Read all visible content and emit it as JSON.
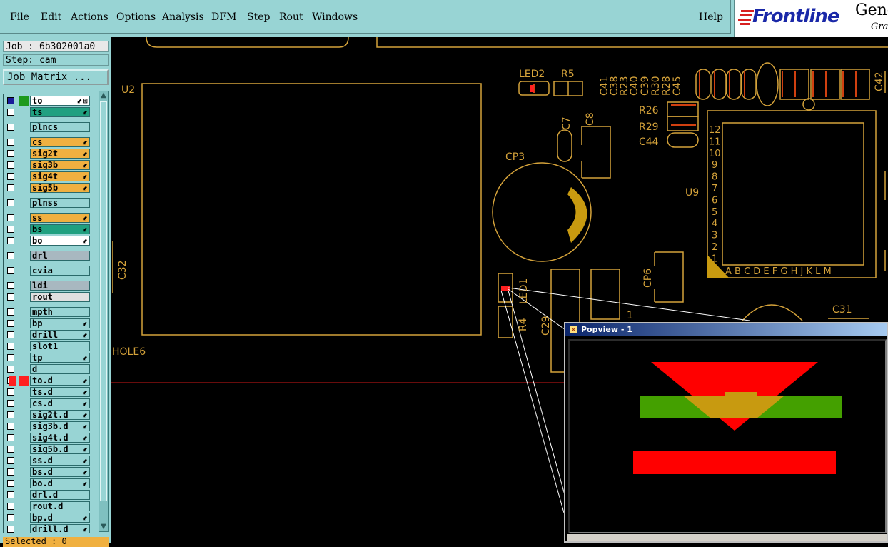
{
  "menubar": {
    "items": [
      "File",
      "Edit",
      "Actions",
      "Options",
      "Analysis",
      "DFM",
      "Step",
      "Rout",
      "Windows"
    ],
    "help": "Help",
    "logo": "Frontline",
    "logo_product": "Gene",
    "logo_sub": "Gra"
  },
  "sidebar": {
    "job": "Job : 6b302001a0",
    "step": "Step: cam",
    "job_matrix_button": "Job Matrix ...",
    "selected": "Selected : 0",
    "layers": [
      {
        "name": "to",
        "color": "#ffffff",
        "cb": "sel",
        "swatch": "#1a1a9a",
        "swatch2": "#1e9a1e",
        "flag": "⬋⊞"
      },
      {
        "name": "ts",
        "color": "#20a080",
        "cb": "",
        "swatch": "",
        "flag": "⬋"
      },
      {
        "name": "plncs",
        "color": "#98d4d4",
        "cb": "",
        "swatch": "",
        "flag": ""
      },
      {
        "name": "cs",
        "color": "#f0b040",
        "cb": "",
        "swatch": "",
        "flag": "⬋"
      },
      {
        "name": "sig2t",
        "color": "#f0b040",
        "cb": "",
        "swatch": "",
        "flag": "⬋"
      },
      {
        "name": "sig3b",
        "color": "#f0b040",
        "cb": "",
        "swatch": "",
        "flag": "⬋"
      },
      {
        "name": "sig4t",
        "color": "#f0b040",
        "cb": "",
        "swatch": "",
        "flag": "⬋"
      },
      {
        "name": "sig5b",
        "color": "#f0b040",
        "cb": "",
        "swatch": "",
        "flag": "⬋"
      },
      {
        "name": "plnss",
        "color": "#98d4d4",
        "cb": "",
        "swatch": "",
        "flag": ""
      },
      {
        "name": "ss",
        "color": "#f0b040",
        "cb": "",
        "swatch": "",
        "flag": "⬋"
      },
      {
        "name": "bs",
        "color": "#20a080",
        "cb": "",
        "swatch": "",
        "flag": "⬋"
      },
      {
        "name": "bo",
        "color": "#ffffff",
        "cb": "",
        "swatch": "",
        "flag": "⬋"
      },
      {
        "name": "drl",
        "color": "#a8b8c0",
        "cb": "",
        "swatch": "",
        "flag": ""
      },
      {
        "name": "cvia",
        "color": "#98d4d4",
        "cb": "",
        "swatch": "",
        "flag": ""
      },
      {
        "name": "ldi",
        "color": "#a8b8c0",
        "cb": "",
        "swatch": "",
        "flag": ""
      },
      {
        "name": "rout",
        "color": "#e0e0e0",
        "cb": "",
        "swatch": "",
        "flag": ""
      },
      {
        "name": "mpth",
        "color": "#98d4d4",
        "cb": "",
        "swatch": "",
        "flag": ""
      },
      {
        "name": "bp",
        "color": "#98d4d4",
        "cb": "",
        "swatch": "",
        "flag": "⬋"
      },
      {
        "name": "drill",
        "color": "#98d4d4",
        "cb": "",
        "swatch": "",
        "flag": "⬋"
      },
      {
        "name": "slot1",
        "color": "#98d4d4",
        "cb": "",
        "swatch": "",
        "flag": ""
      },
      {
        "name": "tp",
        "color": "#98d4d4",
        "cb": "",
        "swatch": "",
        "flag": "⬋"
      },
      {
        "name": "d",
        "color": "#98d4d4",
        "cb": "",
        "swatch": "",
        "flag": ""
      },
      {
        "name": "to.d",
        "color": "#98d4d4",
        "cb": "",
        "swatch": "#ff2020",
        "flag": "⬋"
      },
      {
        "name": "ts.d",
        "color": "#98d4d4",
        "cb": "",
        "swatch": "",
        "flag": "⬋"
      },
      {
        "name": "cs.d",
        "color": "#98d4d4",
        "cb": "",
        "swatch": "",
        "flag": "⬋"
      },
      {
        "name": "sig2t.d",
        "color": "#98d4d4",
        "cb": "",
        "swatch": "",
        "flag": "⬋"
      },
      {
        "name": "sig3b.d",
        "color": "#98d4d4",
        "cb": "",
        "swatch": "",
        "flag": "⬋"
      },
      {
        "name": "sig4t.d",
        "color": "#98d4d4",
        "cb": "",
        "swatch": "",
        "flag": "⬋"
      },
      {
        "name": "sig5b.d",
        "color": "#98d4d4",
        "cb": "",
        "swatch": "",
        "flag": "⬋"
      },
      {
        "name": "ss.d",
        "color": "#98d4d4",
        "cb": "",
        "swatch": "",
        "flag": "⬋"
      },
      {
        "name": "bs.d",
        "color": "#98d4d4",
        "cb": "",
        "swatch": "",
        "flag": "⬋"
      },
      {
        "name": "bo.d",
        "color": "#98d4d4",
        "cb": "",
        "swatch": "",
        "flag": "⬋"
      },
      {
        "name": "drl.d",
        "color": "#98d4d4",
        "cb": "",
        "swatch": "",
        "flag": ""
      },
      {
        "name": "rout.d",
        "color": "#98d4d4",
        "cb": "",
        "swatch": "",
        "flag": ""
      },
      {
        "name": "bp.d",
        "color": "#98d4d4",
        "cb": "",
        "swatch": "",
        "flag": "⬋"
      },
      {
        "name": "drill.d",
        "color": "#98d4d4",
        "cb": "",
        "swatch": "",
        "flag": "⬋"
      }
    ]
  },
  "canvas": {
    "labels": {
      "u2": "U2",
      "led2": "LED2",
      "r5": "R5",
      "c7": "C7",
      "c8": "C8",
      "cp3": "CP3",
      "r26": "R26",
      "r29": "R29",
      "c44": "C44",
      "u9": "U9",
      "c32": "C32",
      "hole6": "HOLE6",
      "led1": "LED1",
      "r4": "R4",
      "c29": "C29",
      "cp6": "CP6",
      "c31": "C31",
      "c42": "C42",
      "one": "1",
      "top_caps": [
        "C41",
        "C38",
        "R23",
        "C40",
        "C39",
        "R30",
        "R28",
        "C45"
      ],
      "u9_rows": [
        "12",
        "11",
        "10",
        "9",
        "8",
        "7",
        "6",
        "5",
        "4",
        "3",
        "2",
        "1"
      ],
      "u9_cols": "A B C D E F G H J K L M"
    }
  },
  "popview": {
    "title": "Popview - 1"
  },
  "colors": {
    "pcb_outline": "#d4a23a",
    "highlight_red": "#ff0000",
    "highlight_green": "#44a000",
    "panel": "#98d4d4"
  }
}
